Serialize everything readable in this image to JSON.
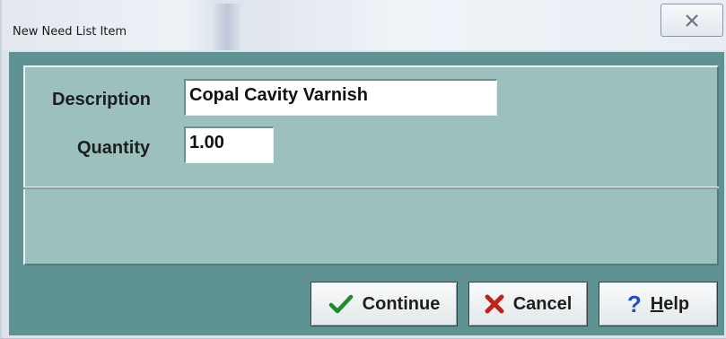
{
  "window": {
    "title": "New Need List Item"
  },
  "form": {
    "description_label": "Description",
    "description_value": "Copal Cavity Varnish",
    "quantity_label": "Quantity",
    "quantity_value": "1.00"
  },
  "buttons": {
    "continue_label": "Continue",
    "cancel_label": "Cancel",
    "help_mnemonic": "H",
    "help_rest": "elp",
    "help_glyph": "?"
  },
  "icons": {
    "close": "close-icon",
    "continue": "checkmark-icon",
    "cancel": "x-icon",
    "help": "question-mark-icon"
  },
  "colors": {
    "client_bg": "#5f9293",
    "panel_bg": "#9cc0bd",
    "check_green": "#1f8a2a",
    "cancel_red": "#c0221a",
    "help_blue": "#1f4fc2"
  }
}
